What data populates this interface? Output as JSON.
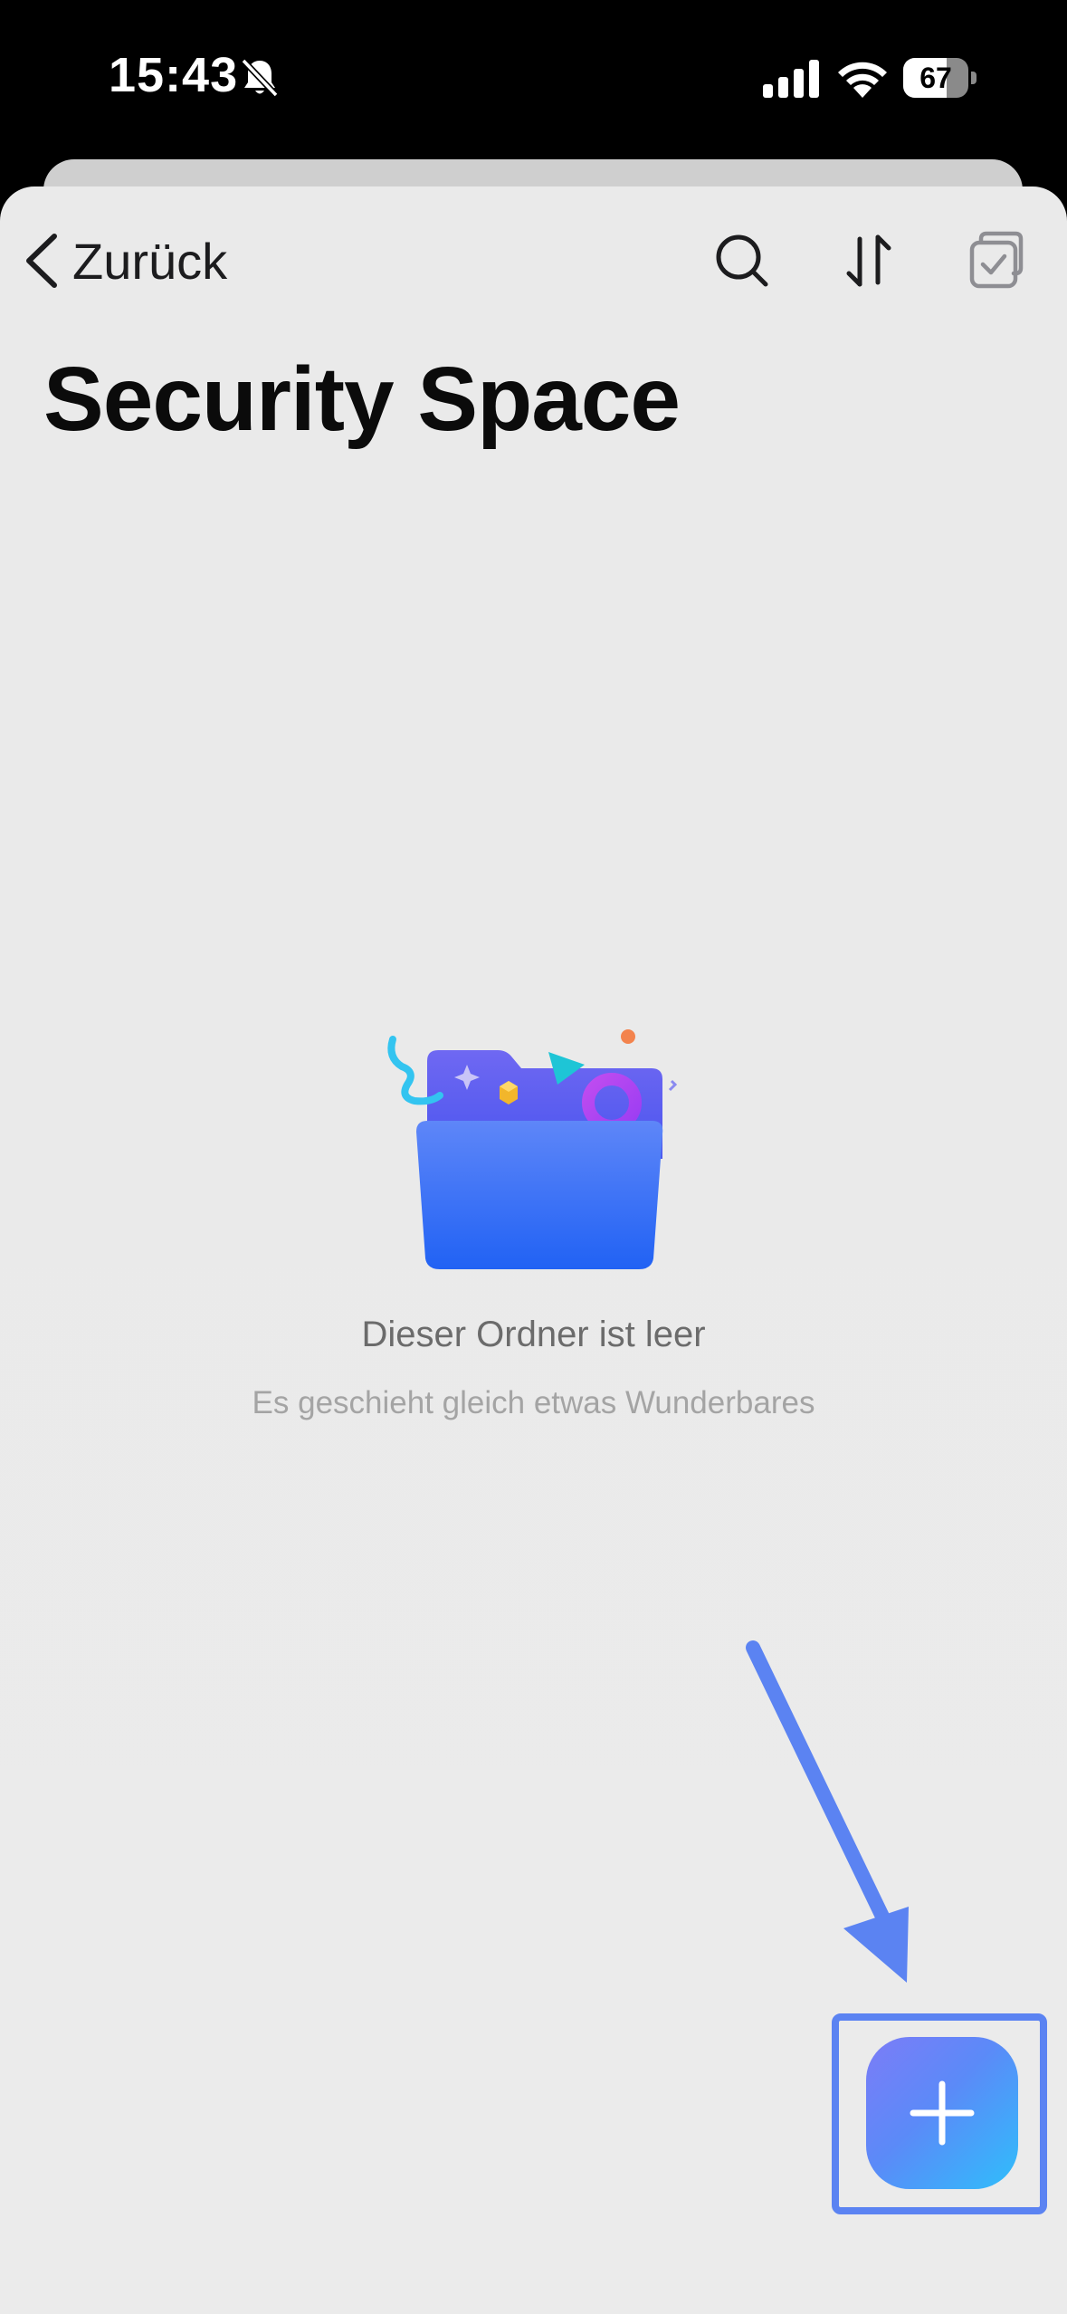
{
  "status_bar": {
    "time": "15:43",
    "battery_level": "67",
    "battery_fraction": 0.67,
    "icons": [
      "bell-slash-icon",
      "cellular-signal-icon",
      "wifi-icon",
      "battery-icon"
    ]
  },
  "nav": {
    "back_label": "Zurück",
    "actions": [
      "search-icon",
      "sort-icon",
      "select-icon"
    ]
  },
  "page": {
    "title": "Security Space"
  },
  "empty_state": {
    "title": "Dieser Ordner ist leer",
    "subtitle": "Es geschieht gleich etwas Wunderbares",
    "illustration": "empty-folder-illustration"
  },
  "fab": {
    "icon": "plus-icon"
  },
  "colors": {
    "sheet_background": "#ebebeb",
    "annotation_blue": "#5b83f2",
    "fab_gradient_start": "#7c7cf7",
    "fab_gradient_end": "#2fbefb",
    "folder_blue": "#2f6bf5"
  }
}
